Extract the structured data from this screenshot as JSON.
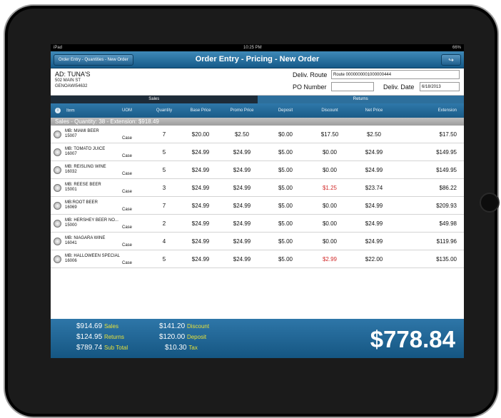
{
  "status": {
    "left": "iPad",
    "time": "10:25 PM",
    "battery": "66%"
  },
  "nav": {
    "back": "Order Entry - Quantities - New Order",
    "title": "Order Entry - Pricing - New Order",
    "share_icon": "share-icon"
  },
  "customer": {
    "name": "AD: TUNA'S",
    "address1": "502 MAIN ST",
    "address2": "GENOAWI54632"
  },
  "delivery": {
    "route_label": "Deliv. Route",
    "route_value": "Route 0000000001000000444",
    "po_label": "PO Number",
    "po_value": "",
    "date_label": "Deliv. Date",
    "date_value": "6/18/2013"
  },
  "tabs": [
    {
      "label": "Sales"
    },
    {
      "label": "Returns"
    }
  ],
  "columns": [
    "Item",
    "UOM",
    "Quantity",
    "Base Price",
    "Promo Price",
    "Deposit",
    "Discount",
    "Net Price",
    "Extension"
  ],
  "group_header": "Sales - Quantity: 38 - Extension: $918.49",
  "rows": [
    {
      "name": "MB: MIAMI BEER",
      "code": "15007",
      "uom": "Case",
      "qty": "7",
      "base": "$20.00",
      "promo": "$2.50",
      "deposit": "$0.00",
      "discount": "$17.50",
      "net": "$2.50",
      "ext": "$17.50",
      "discount_highlight": false
    },
    {
      "name": "MB: TOMATO JUICE",
      "code": "16007",
      "uom": "Case",
      "qty": "5",
      "base": "$24.99",
      "promo": "$24.99",
      "deposit": "$5.00",
      "discount": "$0.00",
      "net": "$24.99",
      "ext": "$149.95",
      "discount_highlight": false
    },
    {
      "name": "MB: REISLING WINE",
      "code": "16032",
      "uom": "Case",
      "qty": "5",
      "base": "$24.99",
      "promo": "$24.99",
      "deposit": "$5.00",
      "discount": "$0.00",
      "net": "$24.99",
      "ext": "$149.95",
      "discount_highlight": false
    },
    {
      "name": "MB: REESE BEER",
      "code": "15001",
      "uom": "Case",
      "qty": "3",
      "base": "$24.99",
      "promo": "$24.99",
      "deposit": "$5.00",
      "discount": "$1.25",
      "net": "$23.74",
      "ext": "$86.22",
      "discount_highlight": true
    },
    {
      "name": "MB:ROOT BEER",
      "code": "16069",
      "uom": "Case",
      "qty": "7",
      "base": "$24.99",
      "promo": "$24.99",
      "deposit": "$5.00",
      "discount": "$0.00",
      "net": "$24.99",
      "ext": "$209.93",
      "discount_highlight": false
    },
    {
      "name": "MB: HERSHEY BEER NO...",
      "code": "15000",
      "uom": "Case",
      "qty": "2",
      "base": "$24.99",
      "promo": "$24.99",
      "deposit": "$5.00",
      "discount": "$0.00",
      "net": "$24.99",
      "ext": "$49.98",
      "discount_highlight": false
    },
    {
      "name": "MB: NIAGARA WINE",
      "code": "16041",
      "uom": "Case",
      "qty": "4",
      "base": "$24.99",
      "promo": "$24.99",
      "deposit": "$5.00",
      "discount": "$0.00",
      "net": "$24.99",
      "ext": "$119.96",
      "discount_highlight": false
    },
    {
      "name": "MB: HALLOWEEN SPECIAL",
      "code": "16006",
      "uom": "Case",
      "qty": "5",
      "base": "$24.99",
      "promo": "$24.99",
      "deposit": "$5.00",
      "discount": "$2.99",
      "net": "$22.00",
      "ext": "$135.00",
      "discount_highlight": true
    }
  ],
  "totals": {
    "sales_value": "$914.69",
    "sales_label": "Sales",
    "returns_value": "$124.95",
    "returns_label": "Returns",
    "subtotal_value": "$789.74",
    "subtotal_label": "Sub Total",
    "discount_value": "$141.20",
    "discount_label": "Discount",
    "deposit_value": "$120.00",
    "deposit_label": "Deposit",
    "tax_value": "$10.30",
    "tax_label": "Tax",
    "grand_total": "$778.84"
  },
  "colors": {
    "nav_blue": "#1f6a9c",
    "highlight_red": "#d22b2b",
    "footer_label_yellow": "#e6e13b"
  }
}
